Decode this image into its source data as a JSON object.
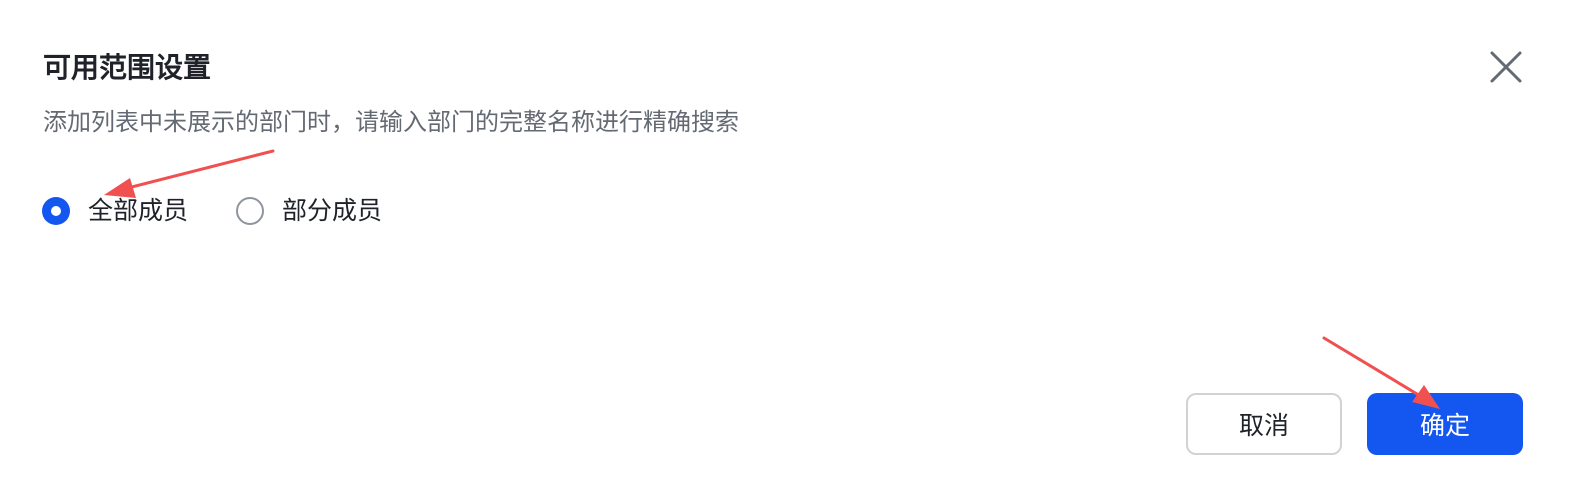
{
  "dialog": {
    "title": "可用范围设置",
    "subtitle": "添加列表中未展示的部门时，请输入部门的完整名称进行精确搜索",
    "close_icon": "close-icon"
  },
  "scope_options": [
    {
      "label": "全部成员",
      "checked": true
    },
    {
      "label": "部分成员",
      "checked": false
    }
  ],
  "footer": {
    "cancel_label": "取消",
    "confirm_label": "确定"
  },
  "colors": {
    "primary": "#1456f0",
    "title_text": "#1f2329",
    "subtitle_text": "#646a73",
    "radio_border": "#8f959e",
    "cancel_border": "#d0d3d6",
    "annotation_arrow": "#f0504f"
  }
}
